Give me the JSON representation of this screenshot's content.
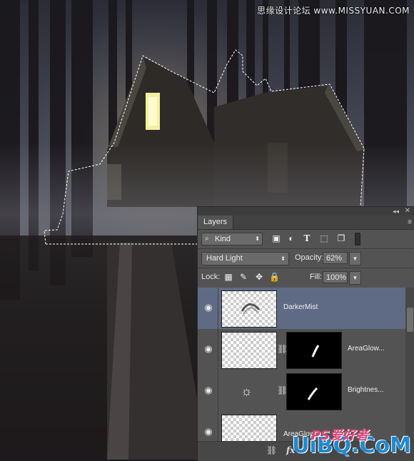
{
  "watermark": {
    "top_text": "思缘设计论坛 www.MISSYUAN.COM",
    "ps_text": "PS爱好者",
    "uibo_text": "UiBQ.CoM"
  },
  "layers_panel": {
    "tab_label": "Layers",
    "filter": {
      "kind_label": "Kind",
      "icons": [
        "image-filter-icon",
        "adjustment-filter-icon",
        "type-filter-icon",
        "shape-filter-icon",
        "smart-object-filter-icon"
      ]
    },
    "blend_mode": "Hard Light",
    "opacity_label": "Opacity:",
    "opacity_value": "62%",
    "lock_label": "Lock:",
    "fill_label": "Fill:",
    "fill_value": "100%",
    "layers": [
      {
        "name": "DarkerMist",
        "selected": true,
        "visible": true,
        "type": "pixel"
      },
      {
        "name": "AreaGlow...",
        "selected": false,
        "visible": true,
        "type": "pixel-with-mask"
      },
      {
        "name": "Brightnes...",
        "selected": false,
        "visible": true,
        "type": "adjustment-with-mask"
      },
      {
        "name": "AreaGlow",
        "selected": false,
        "visible": true,
        "type": "pixel"
      }
    ],
    "bottom_icons": [
      "link-layers-icon",
      "fx-icon"
    ]
  },
  "colors": {
    "panel_bg": "#535353",
    "selected_layer": "#5f6b85",
    "window_glow": "#f4f0a0"
  }
}
